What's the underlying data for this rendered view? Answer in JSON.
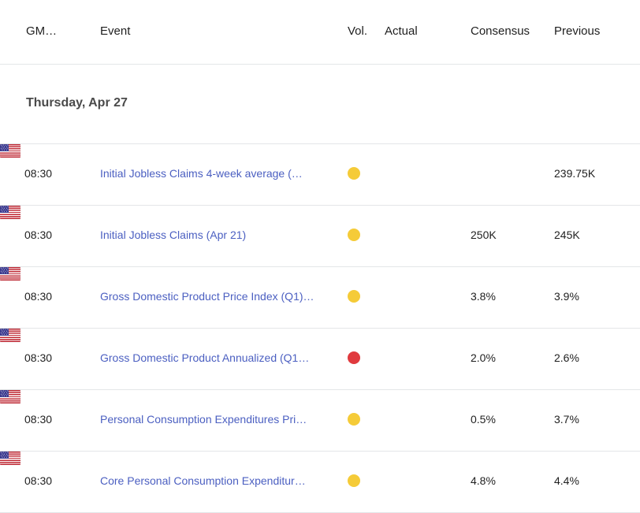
{
  "table": {
    "headers": {
      "time": "GM…",
      "event": "Event",
      "volatility": "Vol.",
      "actual": "Actual",
      "consensus": "Consensus",
      "previous": "Previous"
    },
    "date_group": {
      "label": "Thursday, Apr 27"
    },
    "rows": [
      {
        "time": "08:30",
        "country": "us-flag-icon",
        "event": "Initial Jobless Claims 4-week average (…",
        "volatility": "medium",
        "actual": "",
        "consensus": "",
        "previous": "239.75K"
      },
      {
        "time": "08:30",
        "country": "us-flag-icon",
        "event": "Initial Jobless Claims (Apr 21)",
        "volatility": "medium",
        "actual": "",
        "consensus": "250K",
        "previous": "245K"
      },
      {
        "time": "08:30",
        "country": "us-flag-icon",
        "event": "Gross Domestic Product Price Index (Q1)…",
        "volatility": "medium",
        "actual": "",
        "consensus": "3.8%",
        "previous": "3.9%"
      },
      {
        "time": "08:30",
        "country": "us-flag-icon",
        "event": "Gross Domestic Product Annualized (Q1…",
        "volatility": "high",
        "actual": "",
        "consensus": "2.0%",
        "previous": "2.6%"
      },
      {
        "time": "08:30",
        "country": "us-flag-icon",
        "event": "Personal Consumption Expenditures Pri…",
        "volatility": "medium",
        "actual": "",
        "consensus": "0.5%",
        "previous": "3.7%"
      },
      {
        "time": "08:30",
        "country": "us-flag-icon",
        "event": "Core Personal Consumption Expenditur…",
        "volatility": "medium",
        "actual": "",
        "consensus": "4.8%",
        "previous": "4.4%"
      }
    ]
  },
  "colors": {
    "volatility_medium": "#F5CB38",
    "volatility_high": "#E03A3E",
    "event_link": "#4B5FC1",
    "divider": "#E4E6E8",
    "text": "#1F1F1F",
    "date_text": "#4A4A4A"
  }
}
